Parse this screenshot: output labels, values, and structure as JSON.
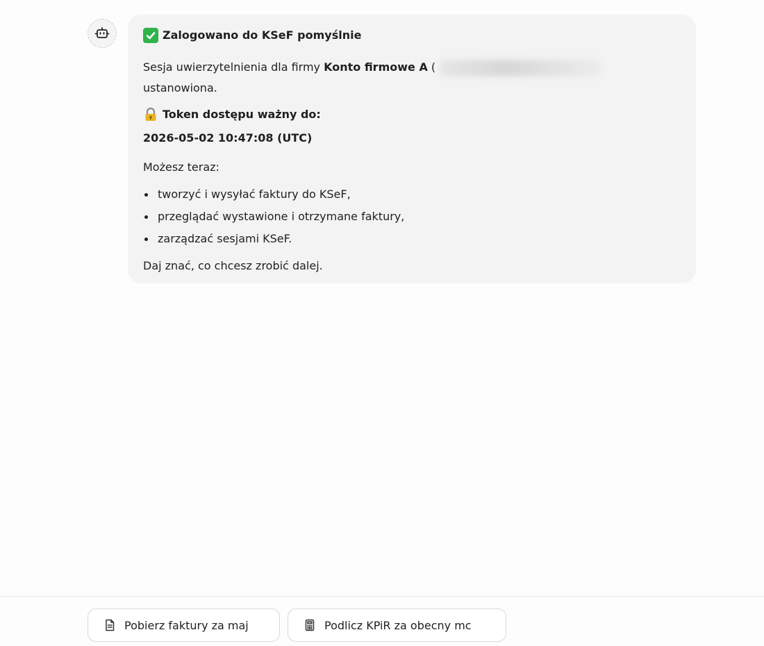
{
  "message": {
    "title": "Zalogowano do KSeF pomyślnie",
    "session_prefix": "Sesja uwierzytelnienia dla firmy ",
    "company_name": "Konto firmowe A",
    "paren_open": " (",
    "session_suffix": "ustanowiona.",
    "token_label": "Token dostępu ważny do:",
    "token_expiry": "2026-05-02 10:47:08 (UTC)",
    "can_now": "Możesz teraz:",
    "actions": [
      "tworzyć i wysyłać faktury do KSeF,",
      "przeglądać wystawione i otrzymane faktury,",
      "zarządzać sesjami KSeF."
    ],
    "closing": "Daj znać, co chcesz zrobić dalej."
  },
  "suggestions": [
    {
      "label": "Pobierz faktury za maj",
      "icon": "document-icon"
    },
    {
      "label": "Podlicz KPiR za obecny mc",
      "icon": "calculator-icon"
    }
  ],
  "colors": {
    "bubble_bg": "#f3f3f3",
    "check_green": "#2fb34a",
    "text": "#1f1f1f"
  }
}
